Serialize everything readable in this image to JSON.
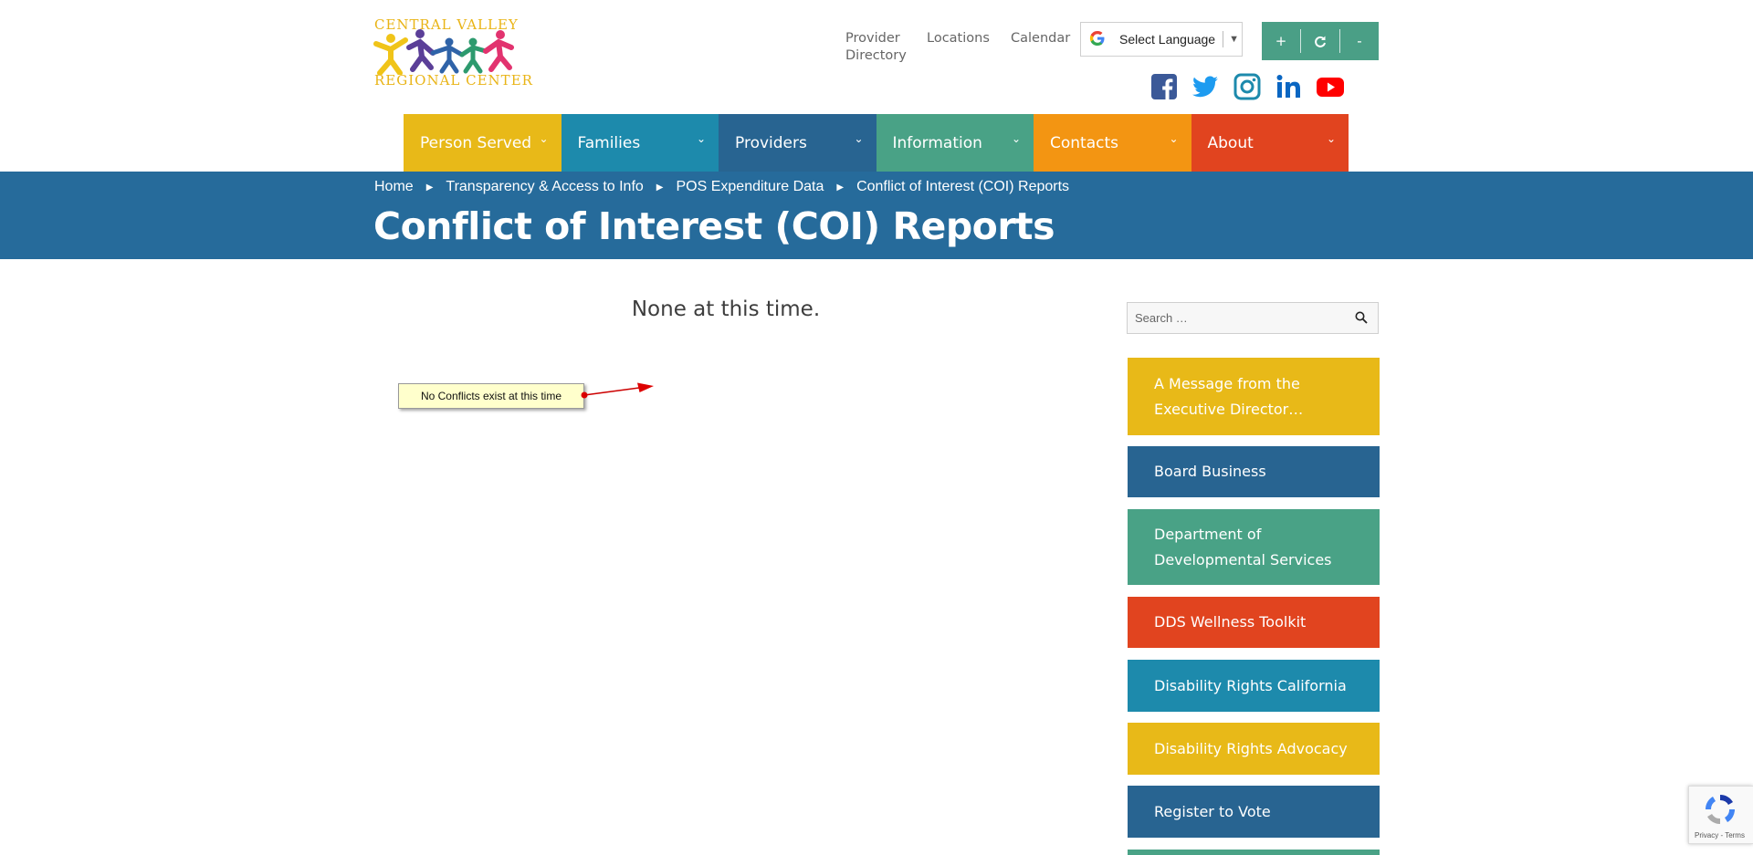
{
  "logo": {
    "line1": "CENTRAL VALLEY",
    "line2": "REGIONAL CENTER"
  },
  "top_links": {
    "provider_directory": "Provider Directory",
    "locations": "Locations",
    "calendar": "Calendar"
  },
  "translate": {
    "label": "Select Language",
    "arrow": "▼",
    "icon": "google-g-icon"
  },
  "font_size_controls": {
    "increase": "+",
    "reset": "↻",
    "decrease": "-",
    "color": "#4a9f86"
  },
  "social": [
    "facebook-icon",
    "twitter-icon",
    "instagram-icon",
    "linkedin-icon",
    "youtube-icon"
  ],
  "nav": [
    {
      "label": "Person Served",
      "color": "#e8b918"
    },
    {
      "label": "Families",
      "color": "#1d8aac"
    },
    {
      "label": "Providers",
      "color": "#286491"
    },
    {
      "label": "Information",
      "color": "#49a286"
    },
    {
      "label": "Contacts",
      "color": "#f39512"
    },
    {
      "label": "About",
      "color": "#e1441f"
    }
  ],
  "breadcrumb": [
    "Home",
    "Transparency & Access to Info",
    "POS Expenditure Data",
    "Conflict of Interest (COI) Reports"
  ],
  "page_title": "Conflict of Interest (COI) Reports",
  "content": {
    "message": "None at this time.",
    "note": "No Conflicts exist at this time"
  },
  "search": {
    "placeholder": "Search …"
  },
  "sidebar_links": [
    {
      "label": "A Message from the Executive Director…",
      "color": "#e8b918"
    },
    {
      "label": "Board Business",
      "color": "#286491"
    },
    {
      "label": "Department of Developmental Services",
      "color": "#49a286"
    },
    {
      "label": "DDS Wellness Toolkit",
      "color": "#e1441f"
    },
    {
      "label": "Disability Rights California",
      "color": "#1d8aac"
    },
    {
      "label": "Disability Rights Advocacy",
      "color": "#e8b918"
    },
    {
      "label": "Register to Vote",
      "color": "#286491"
    },
    {
      "label": "",
      "color": "#49a286"
    }
  ],
  "recaptcha": {
    "terms": "Privacy - Terms"
  },
  "colors": {
    "banner": "#266b9b",
    "logo_text": "#e9b416"
  }
}
